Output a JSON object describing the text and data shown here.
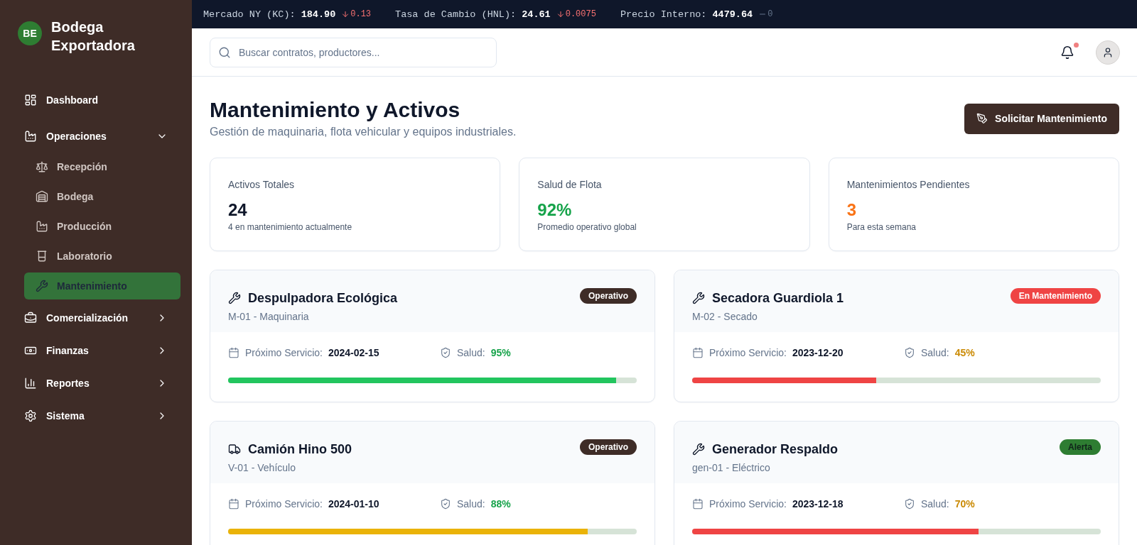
{
  "sidebar": {
    "brand": {
      "initials": "BE",
      "name": "Bodega Exportadora"
    },
    "nav": [
      {
        "kind": "link",
        "label": "Dashboard",
        "selected": false
      },
      {
        "kind": "group",
        "label": "Operaciones",
        "selected": false,
        "expanded": true,
        "children": [
          {
            "label": "Recepción",
            "selected": false
          },
          {
            "label": "Bodega",
            "selected": false
          },
          {
            "label": "Producción",
            "selected": false
          },
          {
            "label": "Laboratorio",
            "selected": false
          },
          {
            "label": "Mantenimiento",
            "selected": true
          }
        ]
      },
      {
        "kind": "group",
        "label": "Comercialización",
        "selected": false,
        "expanded": false
      },
      {
        "kind": "group",
        "label": "Finanzas",
        "selected": false,
        "expanded": false
      },
      {
        "kind": "group",
        "label": "Reportes",
        "selected": false,
        "expanded": false
      },
      {
        "kind": "group",
        "label": "Sistema",
        "selected": false,
        "expanded": false
      }
    ]
  },
  "ticker": [
    {
      "kind": "down",
      "label": "Mercado NY (KC):",
      "value": "184.90",
      "change": "0.13"
    },
    {
      "kind": "down",
      "label": "Tasa de Cambio (HNL):",
      "value": "24.61",
      "change": "0.0075"
    },
    {
      "kind": "flat",
      "label": "Precio Interno:",
      "value": "4479.64",
      "change": "0"
    }
  ],
  "header": {
    "search": {
      "placeholder": "Buscar contratos, productores..."
    },
    "notifications": {
      "unread": true
    }
  },
  "page": {
    "title": "Mantenimiento y Activos",
    "subtitle": "Gestión de maquinaria, flota vehicular y equipos industriales.",
    "action": "Solicitar Mantenimiento"
  },
  "stats": [
    {
      "label": "Activos Totales",
      "value": "24",
      "color": "#0f172a",
      "note": "4 en mantenimiento actualmente"
    },
    {
      "label": "Salud de Flota",
      "value": "92%",
      "color": "#16a34a",
      "note": "Promedio operativo global"
    },
    {
      "label": "Mantenimientos Pendientes",
      "value": "3",
      "color": "#f97316",
      "note": "Para esta semana"
    }
  ],
  "assets": [
    {
      "kind": "machine",
      "name": "Despulpadora Ecológica",
      "code": "M-01 - Maquinaria",
      "status": {
        "kind": "operational",
        "label": "Operativo"
      },
      "service": {
        "label": "Próximo Servicio:",
        "date": "2024-02-15"
      },
      "health": {
        "label": "Salud:",
        "value": "95%",
        "color": "#16a34a"
      },
      "bar": {
        "level": 0.95,
        "color": "#22c55e"
      }
    },
    {
      "kind": "machine",
      "name": "Secadora Guardiola 1",
      "code": "M-02 - Secado",
      "status": {
        "kind": "maintenance",
        "label": "En Mantenimiento"
      },
      "service": {
        "label": "Próximo Servicio:",
        "date": "2023-12-20"
      },
      "health": {
        "label": "Salud:",
        "value": "45%",
        "color": "#ca8a04"
      },
      "bar": {
        "level": 0.45,
        "color": "#ef4444"
      }
    },
    {
      "kind": "vehicle",
      "name": "Camión Hino 500",
      "code": "V-01 - Vehículo",
      "status": {
        "kind": "operational",
        "label": "Operativo"
      },
      "service": {
        "label": "Próximo Servicio:",
        "date": "2024-01-10"
      },
      "health": {
        "label": "Salud:",
        "value": "88%",
        "color": "#16a34a"
      },
      "bar": {
        "level": 0.88,
        "color": "#eab308"
      }
    },
    {
      "kind": "machine",
      "name": "Generador Respaldo",
      "code": "gen-01 - Eléctrico",
      "status": {
        "kind": "alert",
        "label": "Alerta"
      },
      "service": {
        "label": "Próximo Servicio:",
        "date": "2023-12-18"
      },
      "health": {
        "label": "Salud:",
        "value": "70%",
        "color": "#ca8a04"
      },
      "bar": {
        "level": 0.7,
        "color": "#ef4444"
      }
    }
  ]
}
